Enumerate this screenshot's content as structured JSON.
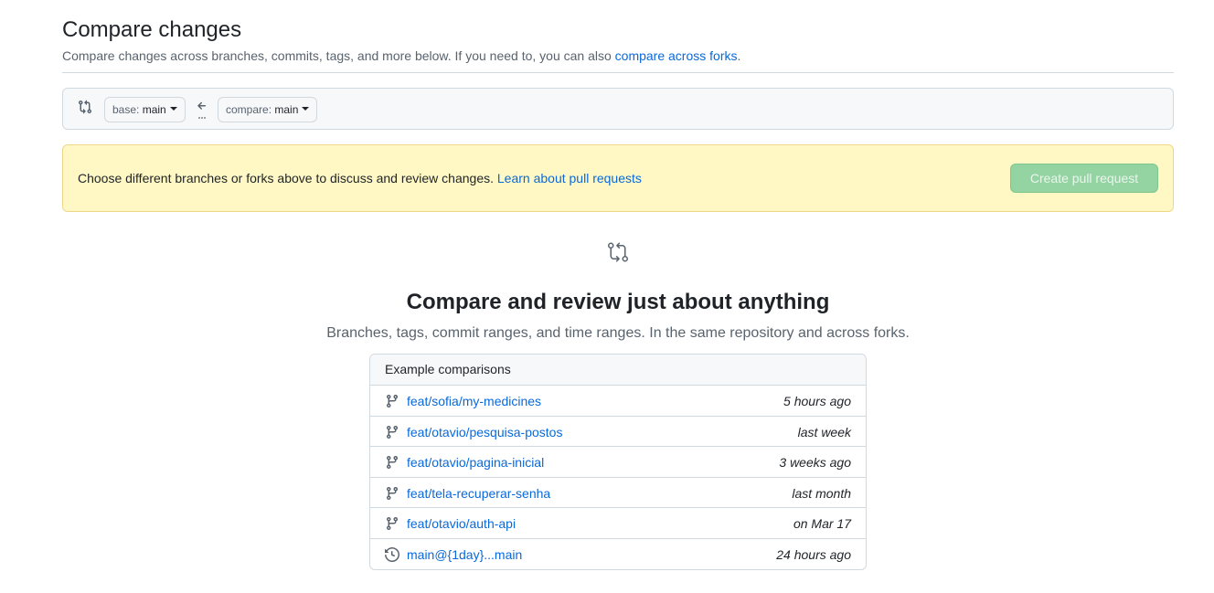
{
  "header": {
    "title": "Compare changes",
    "subtitle_prefix": "Compare changes across branches, commits, tags, and more below. If you need to, you can also ",
    "subtitle_link": "compare across forks",
    "subtitle_suffix": "."
  },
  "range": {
    "base_label": "base:",
    "base_ref": "main",
    "compare_label": "compare:",
    "compare_ref": "main"
  },
  "flash": {
    "message": "Choose different branches or forks above to discuss and review changes.",
    "link": "Learn about pull requests",
    "button": "Create pull request"
  },
  "blankslate": {
    "title": "Compare and review just about anything",
    "description": "Branches, tags, commit ranges, and time ranges. In the same repository and across forks."
  },
  "examples": {
    "header": "Example comparisons",
    "rows": [
      {
        "icon": "git-branch-icon",
        "name": "feat/sofia/my-medicines",
        "time": "5 hours ago"
      },
      {
        "icon": "git-branch-icon",
        "name": "feat/otavio/pesquisa-postos",
        "time": "last week"
      },
      {
        "icon": "git-branch-icon",
        "name": "feat/otavio/pagina-inicial",
        "time": "3 weeks ago"
      },
      {
        "icon": "git-branch-icon",
        "name": "feat/tela-recuperar-senha",
        "time": "last month"
      },
      {
        "icon": "git-branch-icon",
        "name": "feat/otavio/auth-api",
        "time": "on Mar 17"
      },
      {
        "icon": "history-icon",
        "name": "main@{1day}...main",
        "time": "24 hours ago"
      }
    ]
  },
  "colors": {
    "link": "#0969da",
    "flash_bg": "#fff8c5",
    "button_disabled": "#94d3a2"
  }
}
